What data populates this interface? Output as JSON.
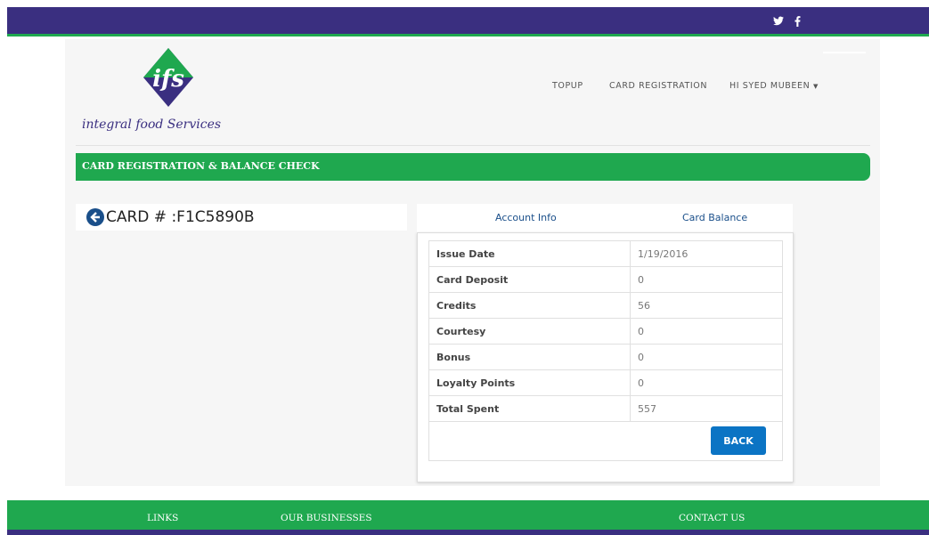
{
  "social": {
    "twitter": "twitter-icon",
    "facebook": "facebook-icon"
  },
  "logo": {
    "letters": "ifs",
    "text": "integral food Services"
  },
  "nav": {
    "topup": "TOPUP",
    "registration": "CARD REGISTRATION",
    "user": "HI SYED MUBEEN"
  },
  "banner": "CARD REGISTRATION & BALANCE CHECK",
  "card": {
    "title": "CARD # :F1C5890B"
  },
  "tabs": {
    "account": "Account Info",
    "balance": "Card Balance"
  },
  "rows": [
    {
      "label": "Issue Date",
      "value": "1/19/2016"
    },
    {
      "label": "Card Deposit",
      "value": "0"
    },
    {
      "label": "Credits",
      "value": "56"
    },
    {
      "label": "Courtesy",
      "value": "0"
    },
    {
      "label": "Bonus",
      "value": "0"
    },
    {
      "label": "Loyalty Points",
      "value": "0"
    },
    {
      "label": "Total Spent",
      "value": "557"
    }
  ],
  "buttons": {
    "back": "BACK"
  },
  "footer": {
    "links": "LINKS",
    "businesses": "OUR BUSINESSES",
    "contact": "CONTACT US"
  },
  "colors": {
    "purple": "#3a2f80",
    "green": "#1fa84f",
    "blue": "#0b74c4"
  }
}
